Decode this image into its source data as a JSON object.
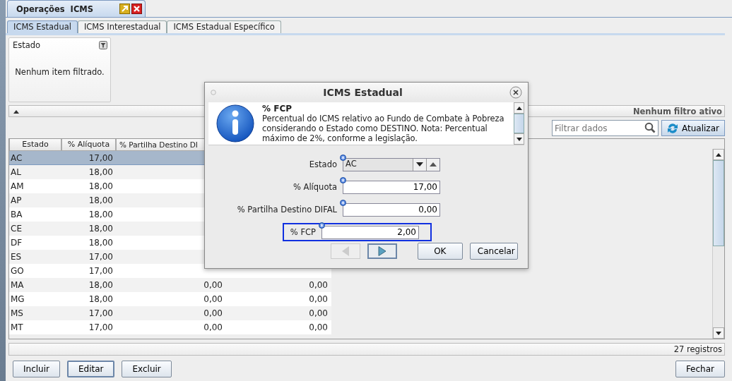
{
  "window_tab": {
    "title": "Operações  ICMS"
  },
  "tabs": [
    {
      "label": "ICMS Estadual",
      "selected": true
    },
    {
      "label": "ICMS Interestadual",
      "selected": false
    },
    {
      "label": "ICMS Estadual Específico",
      "selected": false
    }
  ],
  "filter_panel": {
    "title": "Estado",
    "message": "Nenhum item filtrado."
  },
  "filter_bar": {
    "status": "Nenhum filtro ativo"
  },
  "search": {
    "placeholder": "Filtrar dados"
  },
  "refresh_button": {
    "label": "Atualizar"
  },
  "table": {
    "columns": [
      "Estado",
      "% Alíquota",
      "% Partilha Destino DI"
    ],
    "rows": [
      {
        "cells": [
          "AC",
          "17,00"
        ],
        "selected": true
      },
      {
        "cells": [
          "AL",
          "18,00"
        ],
        "selected": false
      },
      {
        "cells": [
          "AM",
          "18,00"
        ],
        "selected": false
      },
      {
        "cells": [
          "AP",
          "18,00"
        ],
        "selected": false
      },
      {
        "cells": [
          "BA",
          "18,00"
        ],
        "selected": false
      },
      {
        "cells": [
          "CE",
          "18,00"
        ],
        "selected": false
      },
      {
        "cells": [
          "DF",
          "18,00"
        ],
        "selected": false
      },
      {
        "cells": [
          "ES",
          "17,00"
        ],
        "selected": false
      },
      {
        "cells": [
          "GO",
          "17,00"
        ],
        "selected": false
      },
      {
        "cells": [
          "MA",
          "18,00",
          "0,00",
          "0,00"
        ],
        "selected": false
      },
      {
        "cells": [
          "MG",
          "18,00",
          "0,00",
          "0,00"
        ],
        "selected": false
      },
      {
        "cells": [
          "MS",
          "17,00",
          "0,00",
          "0,00"
        ],
        "selected": false
      },
      {
        "cells": [
          "MT",
          "17,00",
          "0,00",
          "0,00"
        ],
        "selected": false
      }
    ]
  },
  "status_bar": {
    "count": "27 registros"
  },
  "buttons": [
    {
      "label": "Incluir",
      "focused": false
    },
    {
      "label": "Editar",
      "focused": true
    },
    {
      "label": "Excluir",
      "focused": false
    }
  ],
  "close_button": {
    "label": "Fechar"
  },
  "dialog": {
    "title": "ICMS Estadual",
    "help_title": "% FCP",
    "help_text": "Percentual do ICMS relativo ao Fundo de Combate à Pobreza considerando o Estado como DESTINO. Nota: Percentual máximo de 2%, conforme a legislação.",
    "fields": [
      {
        "kind": "combo",
        "label": "Estado",
        "value": "AC",
        "focused": false
      },
      {
        "kind": "text",
        "label": "% Alíquota",
        "value": "17,00",
        "focused": false
      },
      {
        "kind": "text",
        "label": "% Partilha Destino DIFAL",
        "value": "0,00",
        "focused": false
      },
      {
        "kind": "text",
        "label": "% FCP",
        "value": "2,00",
        "focused": true
      }
    ],
    "nav_buttons": [
      {
        "kind": "previous",
        "disabled": true
      },
      {
        "kind": "next",
        "disabled": false
      }
    ],
    "buttons": [
      {
        "label": "OK"
      },
      {
        "label": "Cancelar"
      }
    ]
  }
}
